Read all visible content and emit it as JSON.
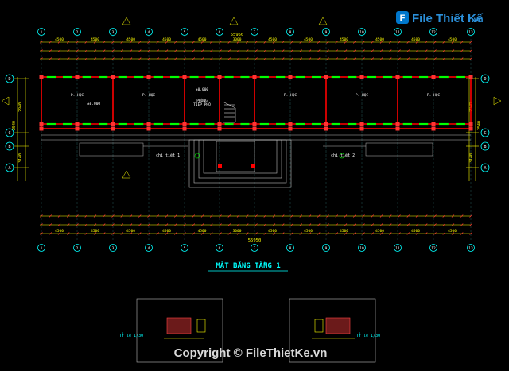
{
  "drawing": {
    "title": "MẶT BẰNG TẦNG 1",
    "total_dim": "55950",
    "axis_labels_top": [
      "1",
      "2",
      "3",
      "4",
      "5",
      "6",
      "7",
      "8",
      "9",
      "10",
      "11",
      "12",
      "13",
      "14"
    ],
    "axis_labels_left": [
      "D",
      "C",
      "B",
      "A"
    ],
    "room_labels": [
      "P. HỌC",
      "P. HỌC",
      "PHÒNG\nTIẾP PHỐ",
      "P. HỌC",
      "P. HỌC",
      "P. HỌC"
    ],
    "room_label_lines": {
      "r1": "P. HỌC",
      "r2": "P. HỌC",
      "r3a": "PHÒNG",
      "r3b": "TIẾP PHỐ",
      "r4": "P. HỌC",
      "r5": "P. HỌC",
      "r6": "P. HỌC"
    },
    "level_label": "±0.000",
    "stair_label_left": "chi tiết 1",
    "stair_label_right": "chi tiết 2",
    "bay_dim": "4500",
    "bay_dims_top": [
      "4500",
      "4500",
      "4500",
      "4500",
      "4500",
      "3000",
      "4500",
      "4500",
      "4500",
      "4500",
      "4500",
      "4500",
      "4500"
    ],
    "detail_label_left": "TỶ lệ 1/30",
    "detail_label_right": "TỶ lệ 1/30",
    "left_vertical_dims": [
      "2940",
      "2540",
      "3140"
    ],
    "right_vertical_dims": [
      "2940",
      "2540",
      "3140"
    ]
  },
  "watermark": {
    "logo_text": "File Thiết Kế",
    "logo_suffix": ".vn",
    "copyright": "Copyright © FileThietKe.vn"
  },
  "colors": {
    "background": "#000000",
    "dim": "#ffff00",
    "axis": "#00ffff",
    "wall": "#ff0000",
    "window": "#00ff00",
    "text": "#ffffff",
    "title": "#00ffff",
    "logo_bg": "#0077cc"
  }
}
